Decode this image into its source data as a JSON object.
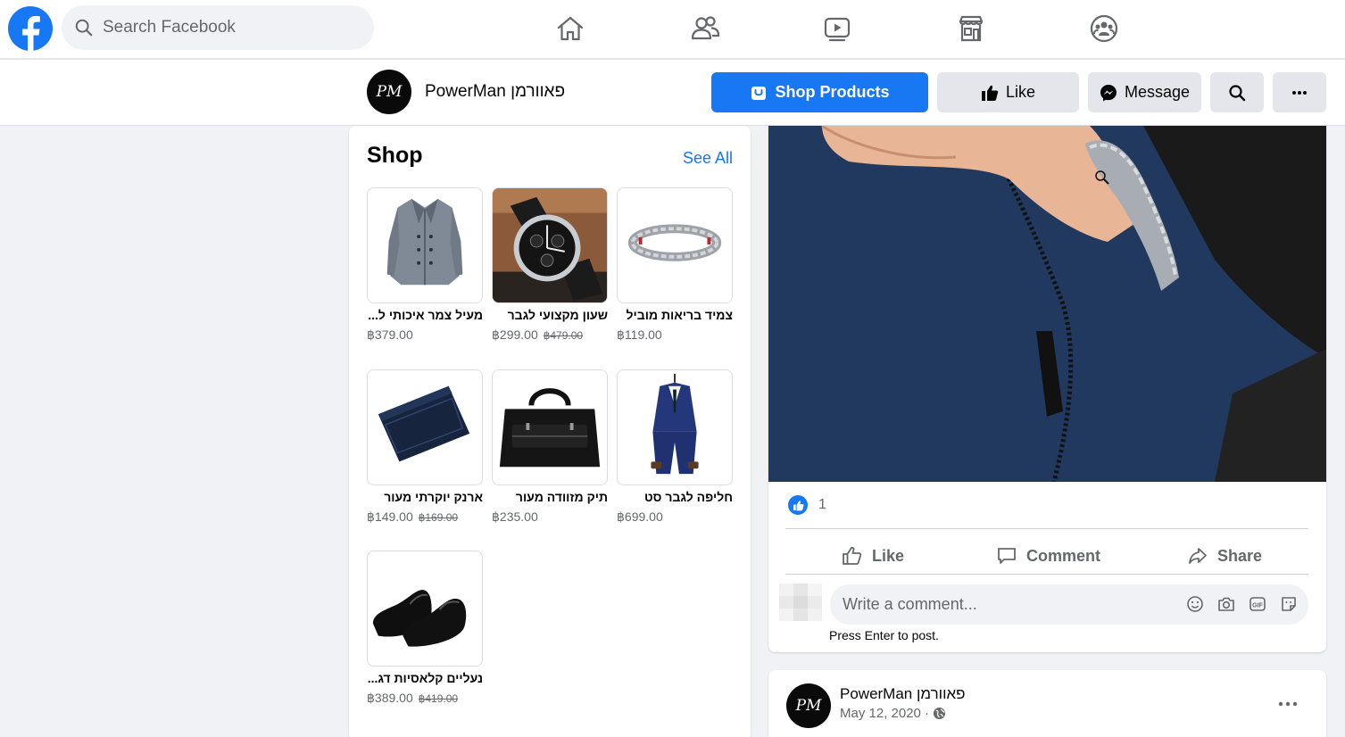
{
  "topnav": {
    "search_placeholder": "Search Facebook",
    "icons": [
      "home-icon",
      "friends-icon",
      "watch-icon",
      "marketplace-icon",
      "groups-icon"
    ]
  },
  "page": {
    "avatar_text": "PM",
    "name": "PowerMan פאוורמן",
    "buttons": {
      "shop": "Shop Products",
      "like": "Like",
      "message": "Message"
    }
  },
  "shop": {
    "title": "Shop",
    "see_all": "See All",
    "products": [
      {
        "name": "מעיל צמר איכותי ל...",
        "price": "฿379.00",
        "old_price": ""
      },
      {
        "name": "שעון מקצועי לגבר",
        "price": "฿299.00",
        "old_price": "฿479.00"
      },
      {
        "name": "צמיד בריאות מוביל",
        "price": "฿119.00",
        "old_price": ""
      },
      {
        "name": "ארנק יוקרתי מעור",
        "price": "฿149.00",
        "old_price": "฿169.00"
      },
      {
        "name": "תיק מזוודה מעור",
        "price": "฿235.00",
        "old_price": ""
      },
      {
        "name": "חליפה לגבר סט",
        "price": "฿699.00",
        "old_price": ""
      },
      {
        "name": "נעליים קלאסיות דג...",
        "price": "฿389.00",
        "old_price": "฿419.00"
      }
    ]
  },
  "post": {
    "like_count": "1",
    "actions": {
      "like": "Like",
      "comment": "Comment",
      "share": "Share"
    },
    "comment_placeholder": "Write a comment...",
    "press_enter": "Press Enter to post."
  },
  "post2": {
    "avatar_text": "PM",
    "author": "PowerMan פאוורמן",
    "date": "May 12, 2020 ·"
  },
  "colors": {
    "brand": "#1877f2",
    "background": "#f0f2f5",
    "secondary_text": "#65676b"
  }
}
